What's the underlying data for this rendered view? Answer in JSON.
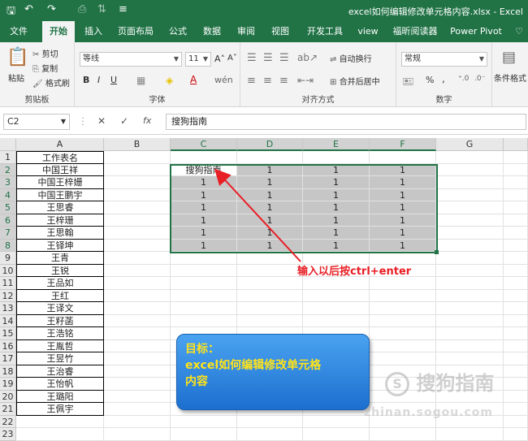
{
  "window": {
    "title": "excel如何编辑修改单元格内容.xlsx - Excel"
  },
  "ribbon_tabs": [
    {
      "label": "文件"
    },
    {
      "label": "开始"
    },
    {
      "label": "插入"
    },
    {
      "label": "页面布局"
    },
    {
      "label": "公式"
    },
    {
      "label": "数据"
    },
    {
      "label": "审阅"
    },
    {
      "label": "视图"
    },
    {
      "label": "开发工具"
    },
    {
      "label": "view"
    },
    {
      "label": "福昕阅读器"
    },
    {
      "label": "Power Pivot"
    }
  ],
  "ribbon": {
    "paste": "粘贴",
    "cut": "剪切",
    "copy": "复制",
    "format_painter": "格式刷",
    "clipboard": "剪贴板",
    "font_name": "等线",
    "font_size": "11",
    "font_group": "字体",
    "wrap": "自动换行",
    "merge": "合并后居中",
    "align_group": "对齐方式",
    "number_format": "常规",
    "percent": "%",
    "comma": ",",
    "number_group": "数字",
    "cond_format": "条件格式"
  },
  "formula_bar": {
    "name_box": "C2",
    "fx": "fx",
    "formula": "搜狗指南"
  },
  "columns": [
    "A",
    "B",
    "C",
    "D",
    "E",
    "F",
    "G"
  ],
  "rows": [
    "1",
    "2",
    "3",
    "4",
    "5",
    "6",
    "7",
    "8",
    "9",
    "10",
    "11",
    "12",
    "13",
    "14",
    "15",
    "16",
    "17",
    "18",
    "19",
    "20",
    "21",
    "22",
    "23"
  ],
  "col_a": [
    "工作表名",
    "中国王祥",
    "中国王梓姗",
    "中国王鹏宇",
    "王思睿",
    "王梓珊",
    "王思翰",
    "王铎坤",
    "王青",
    "王锐",
    "王品如",
    "王红",
    "王译文",
    "王籽菡",
    "王浩铭",
    "王胤哲",
    "王昱竹",
    "王治睿",
    "王怡帆",
    "王璐阳",
    "王佩宇"
  ],
  "selection_values": {
    "c2": "搜狗指南",
    "fill_value": "1"
  },
  "annotation": "输入以后按ctrl+enter",
  "goal": {
    "line1": "目标：",
    "line2": "excel如何编辑修改单元格",
    "line3": "内容"
  },
  "watermark": {
    "text": "搜狗指南",
    "url": "zhinan.sogou.com"
  },
  "colors": {
    "excel_green": "#217346",
    "annotation_red": "#e81e25",
    "goal_blue": "#2a86de",
    "goal_text": "#ffe31a"
  }
}
